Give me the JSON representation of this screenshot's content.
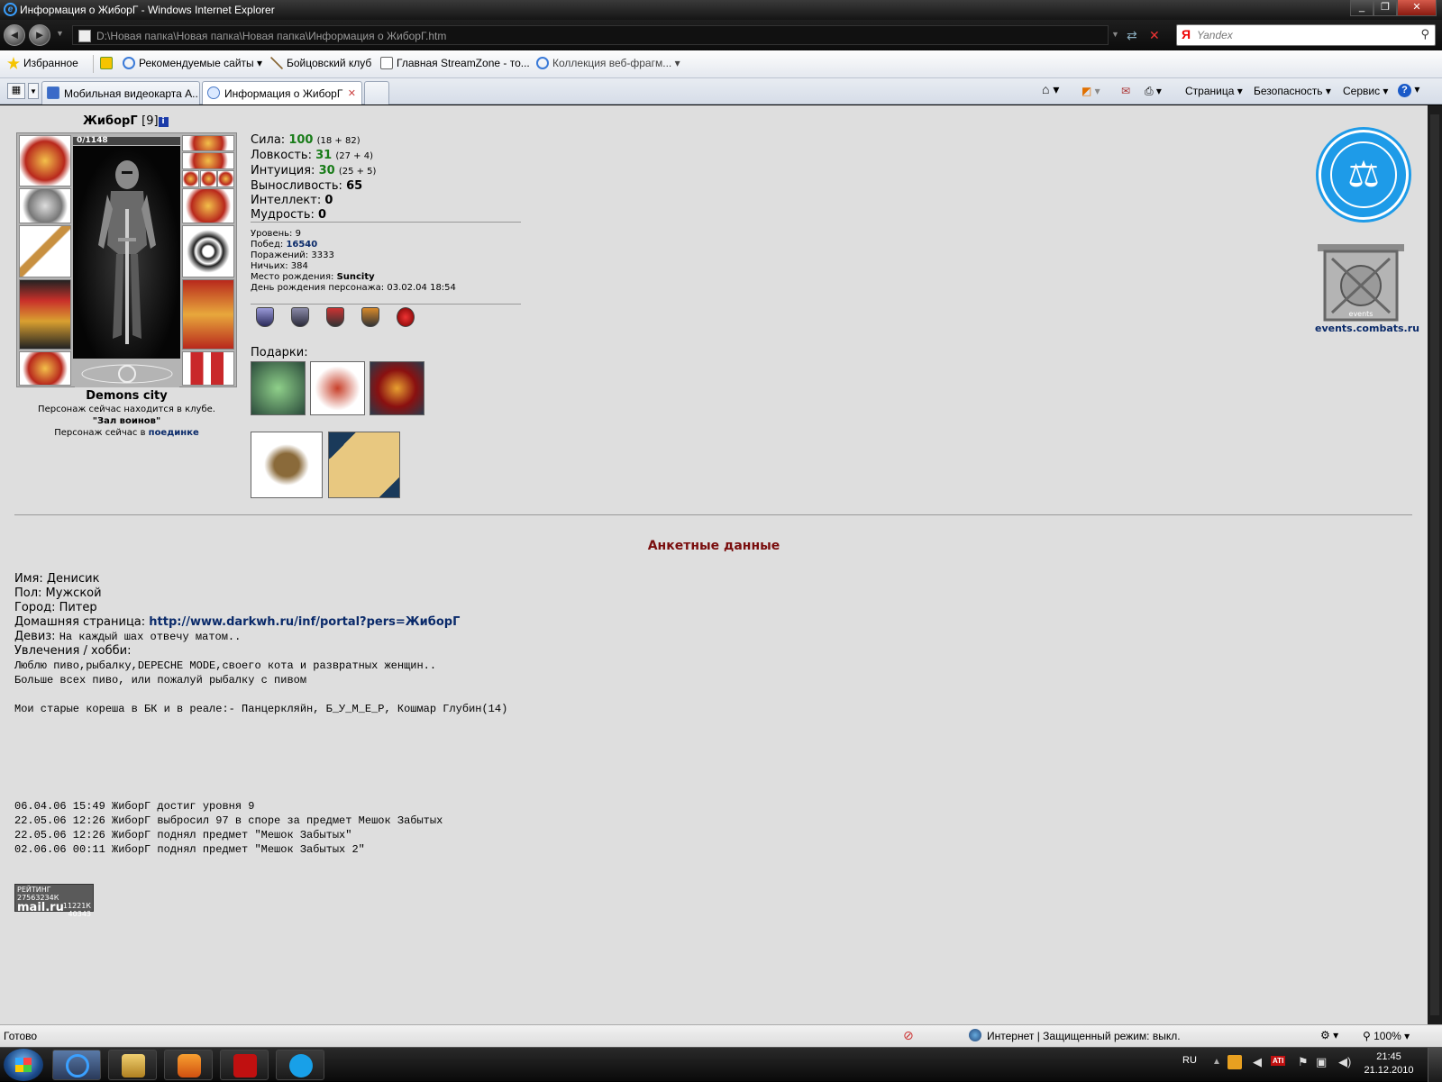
{
  "window": {
    "title": "Информация о ЖиборГ - Windows Internet Explorer"
  },
  "address": {
    "url": "D:\\Новая папка\\Новая папка\\Новая папка\\Информация о ЖиборГ.htm",
    "search_placeholder": "Yandex"
  },
  "favorites": {
    "label": "Избранное",
    "items": [
      "Рекомендуемые сайты",
      "Бойцовский клуб",
      "Главная  StreamZone - то...",
      "Коллекция веб-фрагм..."
    ]
  },
  "tabs": [
    {
      "label": "Мобильная видеокарта A..."
    },
    {
      "label": "Информация о ЖиборГ"
    }
  ],
  "commandbar": {
    "page": "Страница",
    "safety": "Безопасность",
    "tools": "Сервис"
  },
  "character": {
    "name": "ЖиборГ",
    "level": "[9]",
    "hp": "0/1148",
    "city": "Demons city",
    "club_text": "Персонаж сейчас находится в клубе.",
    "club_room": "\"Зал воинов\"",
    "status_prefix": "Персонаж сейчас в",
    "status_link": "поединке"
  },
  "stats": [
    {
      "label": "Сила:",
      "value": "100",
      "extra": "(18 + 82)",
      "color": "green"
    },
    {
      "label": "Ловкость:",
      "value": "31",
      "extra": "(27 + 4)",
      "color": "green"
    },
    {
      "label": "Интуиция:",
      "value": "30",
      "extra": "(25 + 5)",
      "color": "green"
    },
    {
      "label": "Выносливость:",
      "value": "65",
      "extra": "",
      "color": "black"
    },
    {
      "label": "Интеллект:",
      "value": "0",
      "extra": "",
      "color": "black"
    },
    {
      "label": "Мудрость:",
      "value": "0",
      "extra": "",
      "color": "black"
    }
  ],
  "info": {
    "level_label": "Уровень:",
    "level": "9",
    "wins_label": "Побед:",
    "wins": "16540",
    "losses_label": "Поражений:",
    "losses": "3333",
    "draws_label": "Ничьих:",
    "draws": "384",
    "birthplace_label": "Место рождения:",
    "birthplace": "Suncity",
    "birthday_label": "День рождения персонажа:",
    "birthday": "03.02.04 18:54"
  },
  "gifts_label": "Подарки:",
  "events_label": "events.combats.ru",
  "events_small": "events",
  "anket": {
    "title": "Анкетные данные",
    "name": "Имя: Денисик",
    "sex": "Пол: Мужской",
    "city": "Город: Питер",
    "homepage_label": "Домашняя страница:",
    "homepage": "http://www.darkwh.ru/inf/portal?pers=ЖиборГ",
    "motto_label": "Девиз:",
    "motto": "На каждый шах отвечу матом..",
    "hobby_label": "Увлечения / хобби:",
    "hobby_lines": [
      "Люблю пиво,рыбалку,DEPECHE MODE,своего кота и развратных женщин..",
      "Больше всех пиво, или пожалуй рыбалку с пивом",
      "",
      "Мои старые кореша в БК и в реале:- Панцеркляйн, Б_У_М_Е_Р, Кошмар Глубин(14)"
    ]
  },
  "history": [
    "06.04.06 15:49 ЖиборГ достиг уровня 9",
    "22.05.06 12:26 ЖиборГ выбросил 97 в споре за предмет Мешок Забытых",
    "22.05.06 12:26 ЖиборГ поднял предмет \"Мешок Забытых\"",
    "02.06.06 00:11 ЖиборГ поднял предмет \"Мешок Забытых 2\""
  ],
  "counter": {
    "title": "РЕЙТИНГ 27563234К",
    "brand": "mail.ru",
    "n1": "11221К",
    "n2": "40343"
  },
  "status": {
    "left": "Готово",
    "zone": "Интернет | Защищенный режим: выкл.",
    "zoom": "100%"
  },
  "taskbar": {
    "lang": "RU",
    "time": "21:45",
    "date": "21.12.2010"
  }
}
